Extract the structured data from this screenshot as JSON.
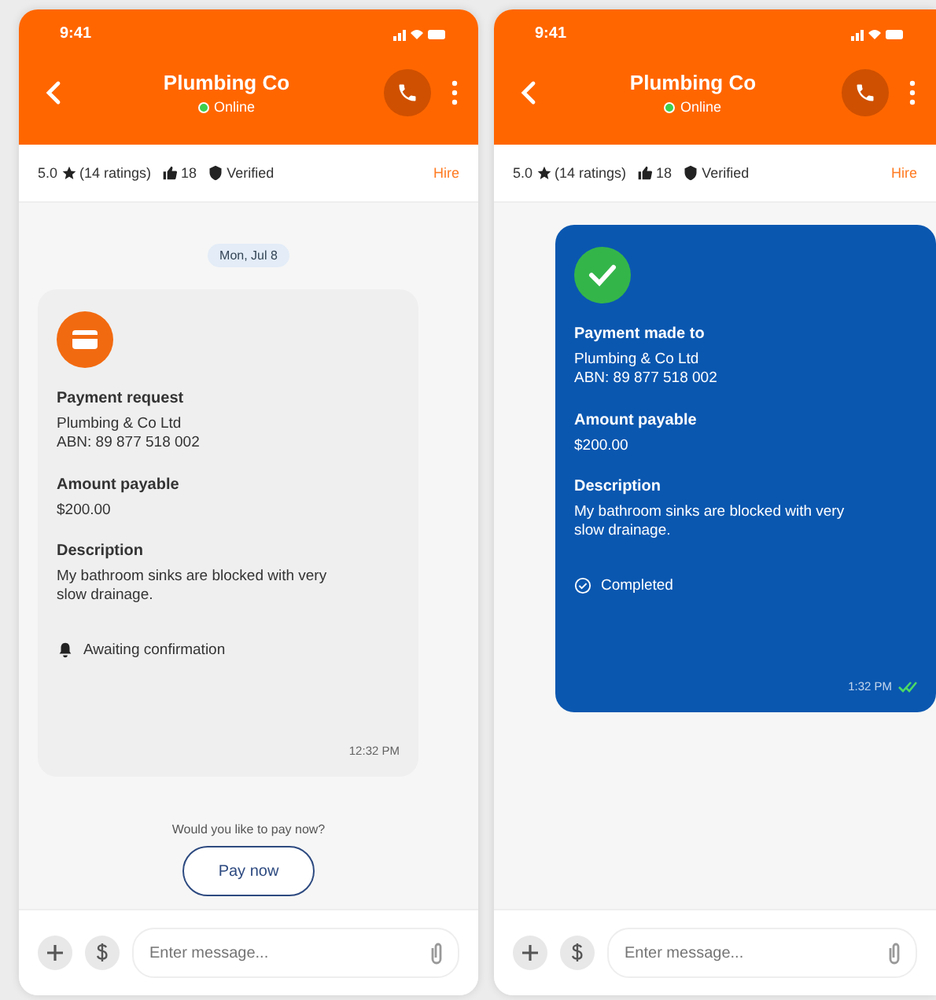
{
  "phones": [
    {
      "status_bar": {
        "time": "9:41"
      },
      "header": {
        "title": "Plumbing Co",
        "status": "Online"
      },
      "info_bar": {
        "rating": "5.0",
        "ratings_count": "(14 ratings)",
        "likes": "18",
        "verified": "Verified",
        "hire": "Hire"
      },
      "date": "Mon, Jul 8",
      "message": {
        "kind": "request",
        "title": "Payment request",
        "payee": "Plumbing & Co Ltd",
        "abn": "ABN: 89 877 518 002",
        "amount_label": "Amount payable",
        "amount": "$200.00",
        "description_label": "Description",
        "description": "My bathroom sinks are blocked with very slow drainage.",
        "status": "Awaiting confirmation",
        "time": "12:32 PM",
        "read_receipt": false
      },
      "prompt": {
        "text": "Would you like to pay now?",
        "button": "Pay now"
      },
      "composer": {
        "placeholder": "Enter message..."
      }
    },
    {
      "status_bar": {
        "time": "9:41"
      },
      "header": {
        "title": "Plumbing Co",
        "status": "Online"
      },
      "info_bar": {
        "rating": "5.0",
        "ratings_count": "(14 ratings)",
        "likes": "18",
        "verified": "Verified",
        "hire": "Hire"
      },
      "message": {
        "kind": "paid",
        "title": "Payment made to",
        "payee": "Plumbing & Co Ltd",
        "abn": "ABN: 89 877 518 002",
        "amount_label": "Amount payable",
        "amount": "$200.00",
        "description_label": "Description",
        "description": "My bathroom sinks are blocked with very slow drainage.",
        "status": "Completed",
        "time": "1:32 PM",
        "read_receipt": true
      },
      "composer": {
        "placeholder": "Enter message..."
      }
    }
  ]
}
